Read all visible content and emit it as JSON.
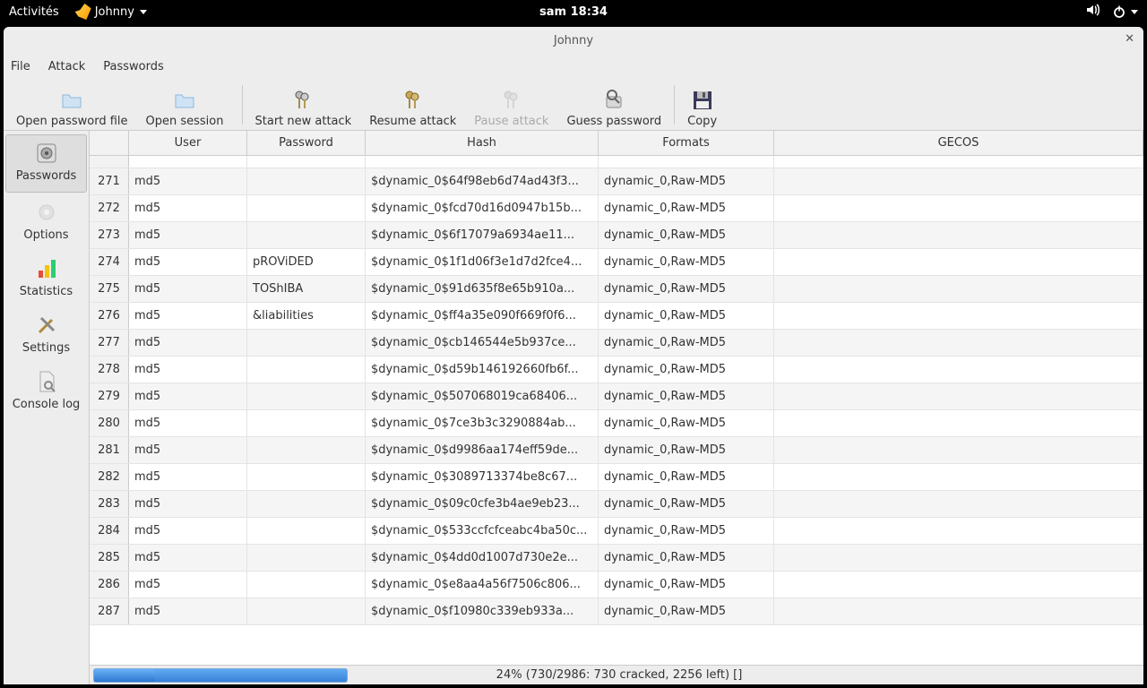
{
  "gnome": {
    "activities": "Activités",
    "app_name": "Johnny",
    "clock": "sam 18:34"
  },
  "window": {
    "title": "Johnny"
  },
  "menubar": [
    "File",
    "Attack",
    "Passwords"
  ],
  "toolbar": {
    "open_file": "Open password file",
    "open_session": "Open session",
    "start_attack": "Start new attack",
    "resume_attack": "Resume attack",
    "pause_attack": "Pause attack",
    "guess_password": "Guess password",
    "copy": "Copy"
  },
  "sidebar": {
    "passwords": "Passwords",
    "options": "Options",
    "statistics": "Statistics",
    "settings": "Settings",
    "consolelog": "Console log"
  },
  "columns": {
    "user": "User",
    "password": "Password",
    "hash": "Hash",
    "formats": "Formats",
    "gecos": "GECOS"
  },
  "rows": [
    {
      "n": "271",
      "user": "md5",
      "pwd": "",
      "hash": "$dynamic_0$64f98eb6d74ad43f3...",
      "fmt": "dynamic_0,Raw-MD5"
    },
    {
      "n": "272",
      "user": "md5",
      "pwd": "",
      "hash": "$dynamic_0$fcd70d16d0947b15b...",
      "fmt": "dynamic_0,Raw-MD5"
    },
    {
      "n": "273",
      "user": "md5",
      "pwd": "",
      "hash": "$dynamic_0$6f17079a6934ae11...",
      "fmt": "dynamic_0,Raw-MD5"
    },
    {
      "n": "274",
      "user": "md5",
      "pwd": "pROViDED",
      "hash": "$dynamic_0$1f1d06f3e1d7d2fce4...",
      "fmt": "dynamic_0,Raw-MD5"
    },
    {
      "n": "275",
      "user": "md5",
      "pwd": "TOShIBA",
      "hash": "$dynamic_0$91d635f8e65b910a...",
      "fmt": "dynamic_0,Raw-MD5"
    },
    {
      "n": "276",
      "user": "md5",
      "pwd": "&liabilities",
      "hash": "$dynamic_0$ff4a35e090f669f0f6...",
      "fmt": "dynamic_0,Raw-MD5"
    },
    {
      "n": "277",
      "user": "md5",
      "pwd": "",
      "hash": "$dynamic_0$cb146544e5b937ce...",
      "fmt": "dynamic_0,Raw-MD5"
    },
    {
      "n": "278",
      "user": "md5",
      "pwd": "",
      "hash": "$dynamic_0$d59b146192660fb6f...",
      "fmt": "dynamic_0,Raw-MD5"
    },
    {
      "n": "279",
      "user": "md5",
      "pwd": "",
      "hash": "$dynamic_0$507068019ca68406...",
      "fmt": "dynamic_0,Raw-MD5"
    },
    {
      "n": "280",
      "user": "md5",
      "pwd": "",
      "hash": "$dynamic_0$7ce3b3c3290884ab...",
      "fmt": "dynamic_0,Raw-MD5"
    },
    {
      "n": "281",
      "user": "md5",
      "pwd": "",
      "hash": "$dynamic_0$d9986aa174eff59de...",
      "fmt": "dynamic_0,Raw-MD5"
    },
    {
      "n": "282",
      "user": "md5",
      "pwd": "",
      "hash": "$dynamic_0$3089713374be8c67...",
      "fmt": "dynamic_0,Raw-MD5"
    },
    {
      "n": "283",
      "user": "md5",
      "pwd": "",
      "hash": "$dynamic_0$09c0cfe3b4ae9eb23...",
      "fmt": "dynamic_0,Raw-MD5"
    },
    {
      "n": "284",
      "user": "md5",
      "pwd": "",
      "hash": "$dynamic_0$533ccfcfceabc4ba50c...",
      "fmt": "dynamic_0,Raw-MD5"
    },
    {
      "n": "285",
      "user": "md5",
      "pwd": "",
      "hash": "$dynamic_0$4dd0d1007d730e2e...",
      "fmt": "dynamic_0,Raw-MD5"
    },
    {
      "n": "286",
      "user": "md5",
      "pwd": "",
      "hash": "$dynamic_0$e8aa4a56f7506c806...",
      "fmt": "dynamic_0,Raw-MD5"
    },
    {
      "n": "287",
      "user": "md5",
      "pwd": "",
      "hash": "$dynamic_0$f10980c339eb933a...",
      "fmt": "dynamic_0,Raw-MD5"
    }
  ],
  "status": "24% (730/2986: 730 cracked, 2256 left) []"
}
